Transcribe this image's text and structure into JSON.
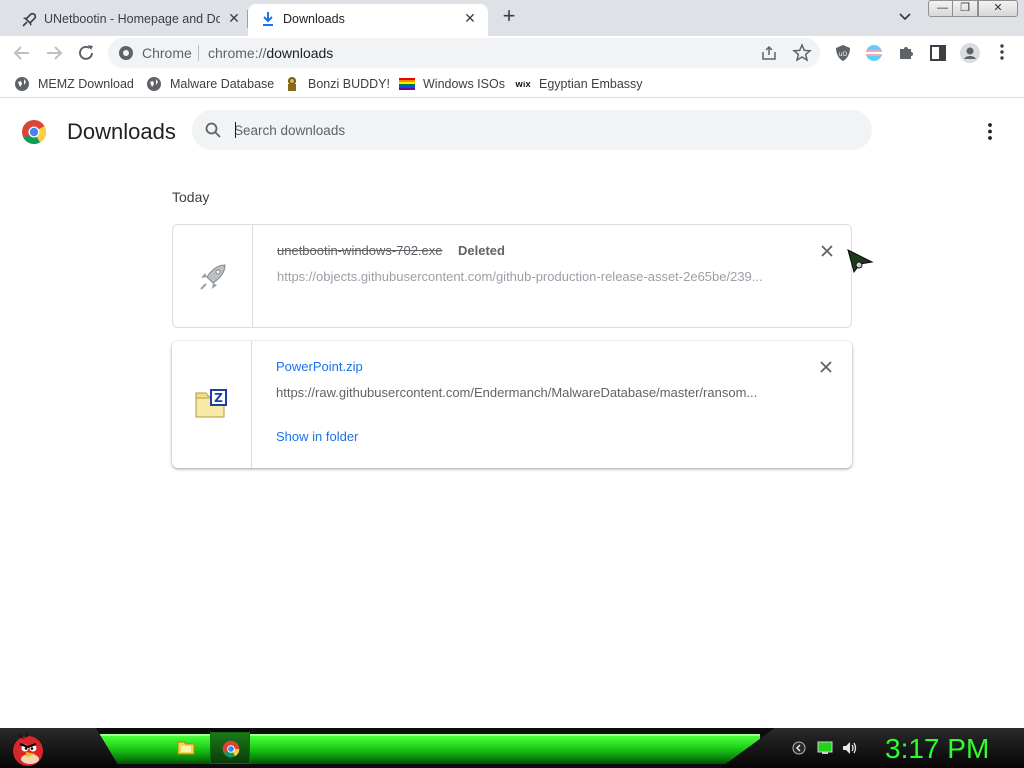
{
  "tabs": [
    {
      "title": "UNetbootin - Homepage and Do",
      "icon": "rocket-icon"
    },
    {
      "title": "Downloads",
      "icon": "download-icon"
    }
  ],
  "omnibox": {
    "chip": "Chrome",
    "scheme": "chrome://",
    "host": "downloads"
  },
  "bookmarks": [
    {
      "label": "MEMZ Download",
      "icon": "globe-icon"
    },
    {
      "label": "Malware Database",
      "icon": "globe-icon"
    },
    {
      "label": "Bonzi BUDDY!",
      "icon": "bonzi-icon"
    },
    {
      "label": "Windows ISOs",
      "icon": "rainbow-flag-icon"
    },
    {
      "label": "Egyptian Embassy",
      "icon": "wix-icon"
    }
  ],
  "page": {
    "title": "Downloads",
    "search_placeholder": "Search downloads"
  },
  "date_header": "Today",
  "downloads": [
    {
      "filename": "unetbootin-windows-702.exe",
      "status": "Deleted",
      "url": "https://objects.githubusercontent.com/github-production-release-asset-2e65be/239...",
      "icon": "rocket-icon"
    },
    {
      "filename": "PowerPoint.zip",
      "status": "",
      "url": "https://raw.githubusercontent.com/Endermanch/MalwareDatabase/master/ransom...",
      "action": "Show in folder",
      "icon": "zip-folder-icon"
    }
  ],
  "taskbar": {
    "clock": "3:17 PM"
  },
  "colors": {
    "accent": "#1a73e8",
    "taskbar_green": "#2cff2c"
  }
}
